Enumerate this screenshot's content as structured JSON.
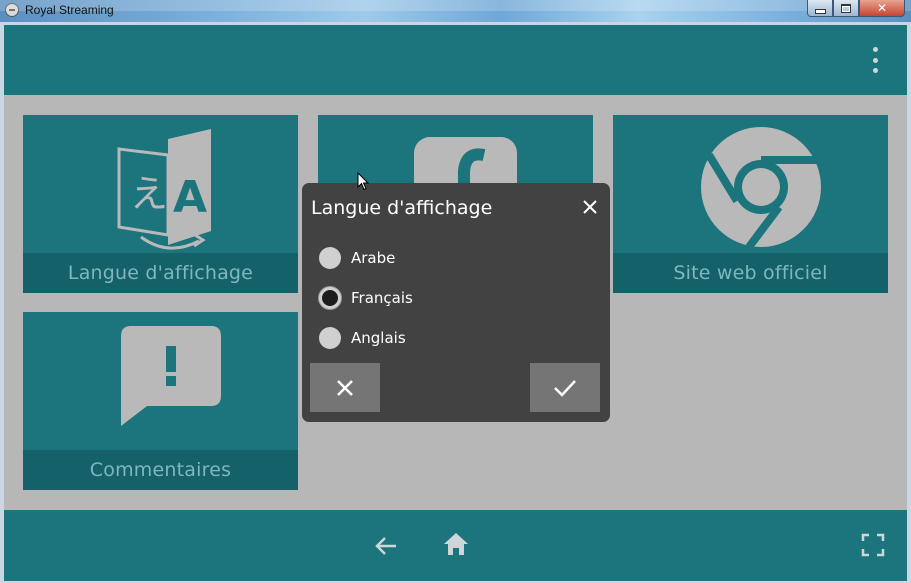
{
  "window": {
    "title": "Royal Streaming",
    "minimize_glyph": "minimize-icon",
    "maximize_glyph": "maximize-icon",
    "close_label": "✕"
  },
  "header": {
    "menu_icon": "more-vertical-icon"
  },
  "tiles": [
    {
      "label": "Langue d'affichage",
      "icon": "translate-icon"
    },
    {
      "label": "",
      "icon": "facebook-icon"
    },
    {
      "label": "Site web officiel",
      "icon": "chrome-icon"
    },
    {
      "label": "Commentaires",
      "icon": "feedback-icon"
    }
  ],
  "footer": {
    "back_icon": "arrow-left-icon",
    "home_icon": "home-icon",
    "fullscreen_icon": "fullscreen-icon"
  },
  "dialog": {
    "title": "Langue d'affichage",
    "options": [
      {
        "label": "Arabe",
        "selected": false
      },
      {
        "label": "Français",
        "selected": true
      },
      {
        "label": "Anglais",
        "selected": false
      }
    ],
    "cancel_icon": "close-icon",
    "confirm_icon": "check-icon"
  },
  "colors": {
    "teal": "#1c747d",
    "teal_dark": "#15616a",
    "background": "#b7b7b7",
    "dialog": "#424242",
    "dialog_button": "#757575",
    "icon_gray": "#b9b9b9"
  }
}
